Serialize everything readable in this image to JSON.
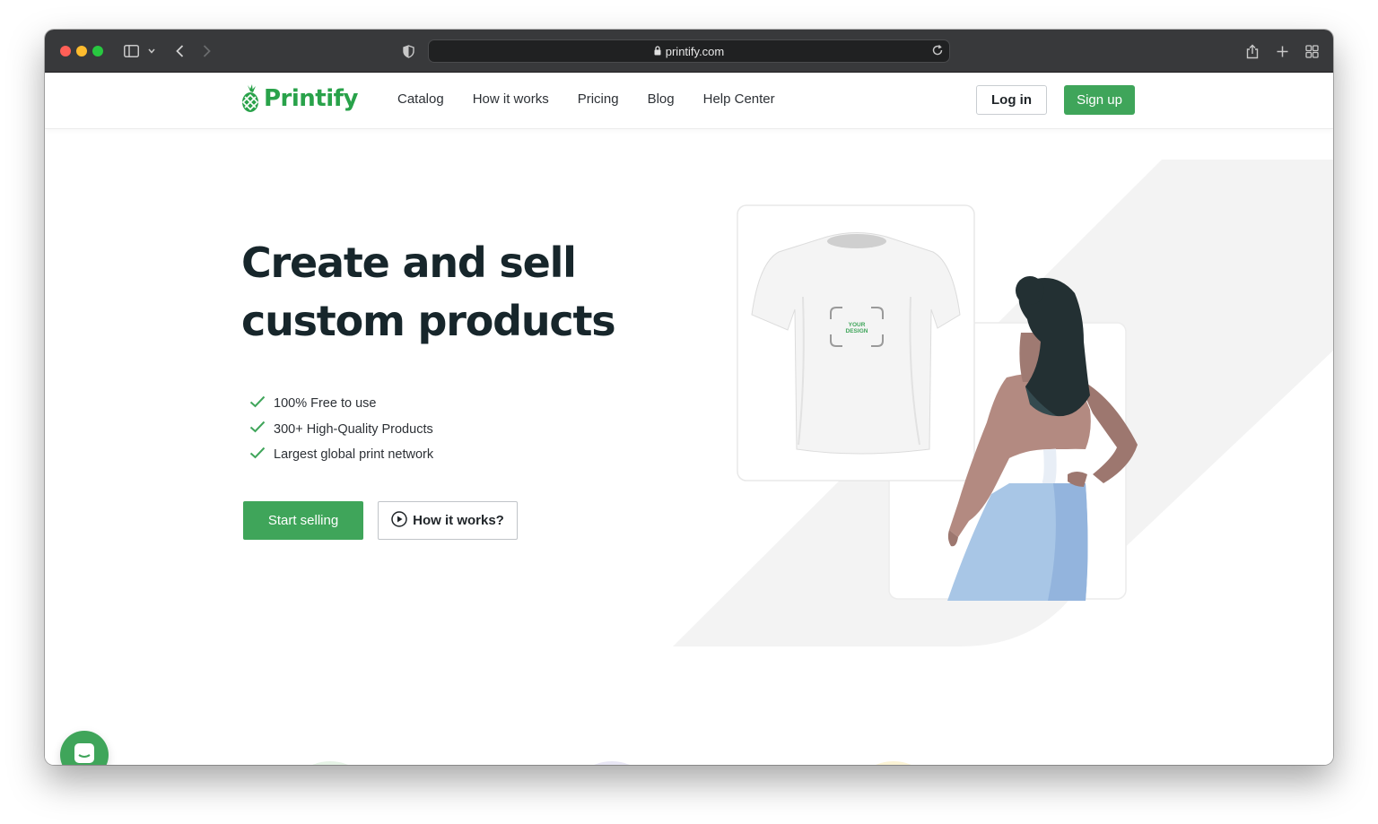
{
  "browser": {
    "url": "printify.com"
  },
  "nav": {
    "logo_text": "Printify",
    "links": [
      "Catalog",
      "How it works",
      "Pricing",
      "Blog",
      "Help Center"
    ],
    "login_label": "Log in",
    "signup_label": "Sign up"
  },
  "hero": {
    "title_line1": "Create and sell",
    "title_line2": "custom products",
    "features": [
      "100% Free to use",
      "300+ High-Quality Products",
      "Largest global print network"
    ],
    "cta_primary": "Start selling",
    "cta_secondary": "How it works?",
    "tshirt_label_line1": "YOUR",
    "tshirt_label_line2": "DESIGN"
  },
  "colors": {
    "brand_green": "#3fa55a",
    "heading": "#17262b",
    "toolbar": "#38393b"
  },
  "icons": {
    "chat": "chat-icon",
    "check": "check-icon",
    "play": "play-circle-icon"
  }
}
